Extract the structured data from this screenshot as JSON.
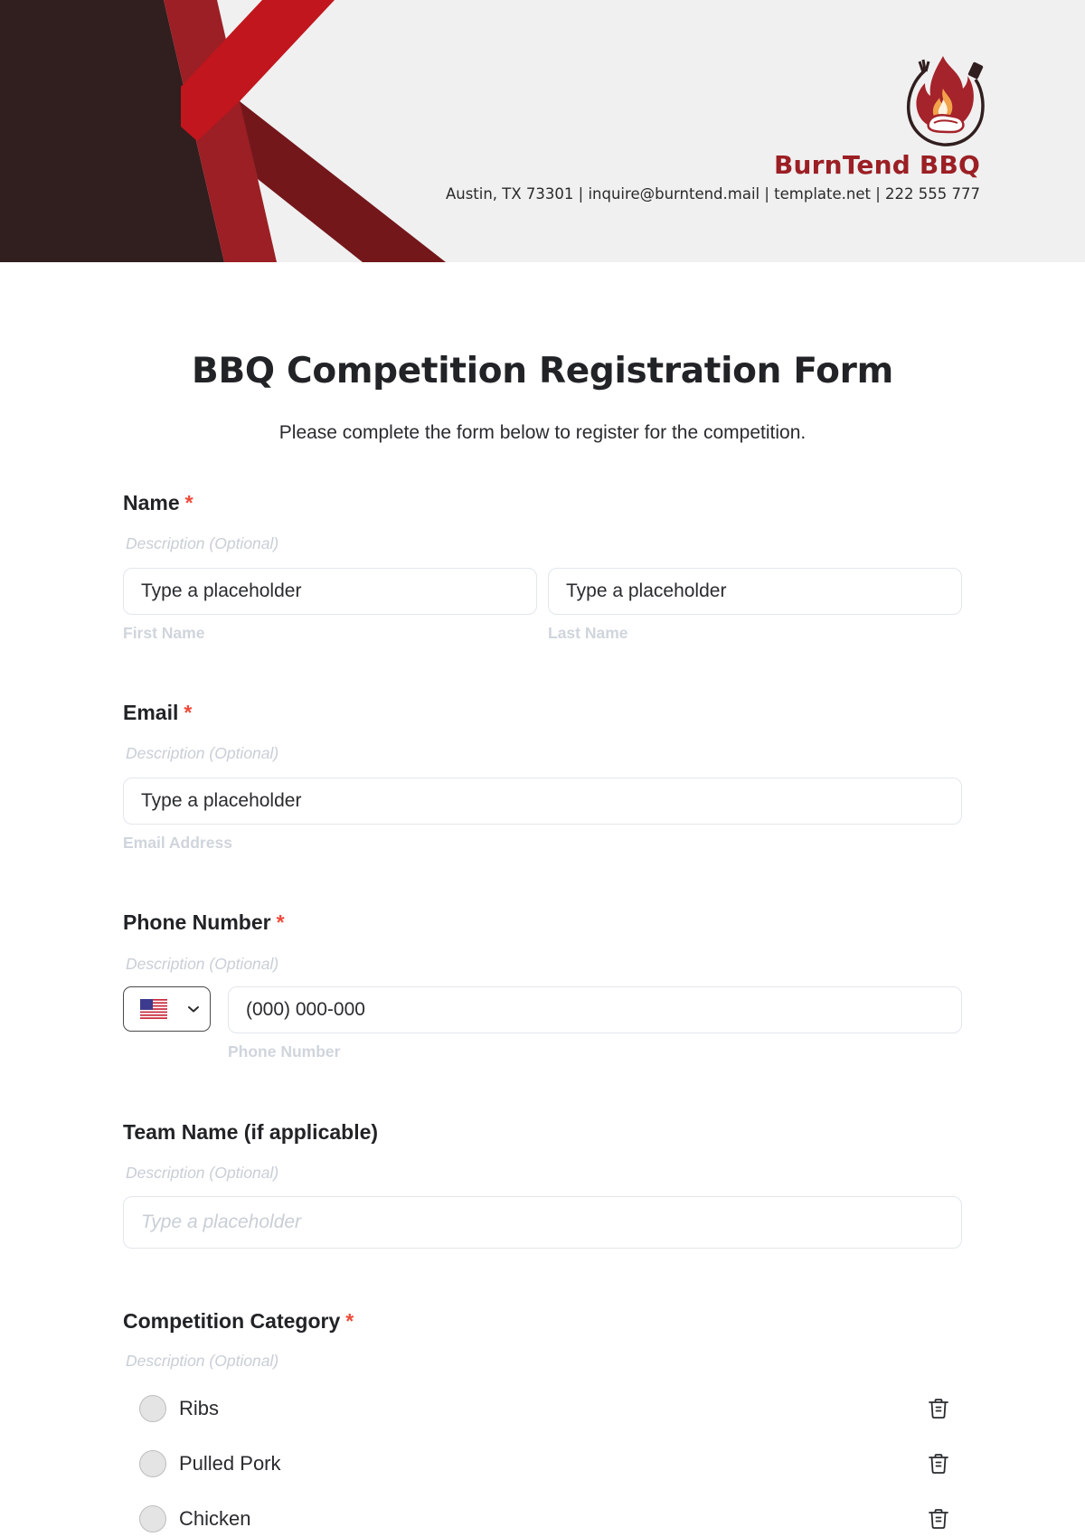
{
  "header": {
    "brand_name": "BurnTend BBQ",
    "contact_line": "Austin, TX 73301 | inquire@burntend.mail | template.net | 222 555 777",
    "logo_icon": "flame-grill-logo-icon",
    "colors": {
      "dark": "#311e1f",
      "mid_red": "#9b1f24",
      "bright_red": "#c1161d",
      "maroon": "#73171b",
      "background": "#f0f0f0",
      "brand": "#9b1f24"
    }
  },
  "form": {
    "title": "BBQ Competition Registration Form",
    "subtitle": "Please complete the form below to register for the competition.",
    "required_marker": "*",
    "fields": {
      "name": {
        "label": "Name",
        "required": true,
        "description": "Description (Optional)",
        "first": {
          "placeholder": "Type a placeholder",
          "sublabel": "First Name"
        },
        "last": {
          "placeholder": "Type a placeholder",
          "sublabel": "Last Name"
        }
      },
      "email": {
        "label": "Email",
        "required": true,
        "description": "Description (Optional)",
        "placeholder": "Type a placeholder",
        "sublabel": "Email Address"
      },
      "phone": {
        "label": "Phone Number",
        "required": true,
        "description": "Description (Optional)",
        "country": "United States",
        "country_icon": "us-flag-icon",
        "placeholder": "(000) 000-000",
        "sublabel": "Phone Number"
      },
      "team": {
        "label": "Team Name (if applicable)",
        "required": false,
        "description": "Description (Optional)",
        "placeholder": "Type a placeholder"
      },
      "category": {
        "label": "Competition Category",
        "required": true,
        "description": "Description (Optional)",
        "options": [
          {
            "label": "Ribs",
            "selected": false
          },
          {
            "label": "Pulled Pork",
            "selected": false
          },
          {
            "label": "Chicken",
            "selected": false
          }
        ]
      }
    }
  },
  "colors": {
    "required": "#f04a3a",
    "text": "#222326",
    "muted": "#c9ced6",
    "input_border": "#e2e6ec"
  }
}
